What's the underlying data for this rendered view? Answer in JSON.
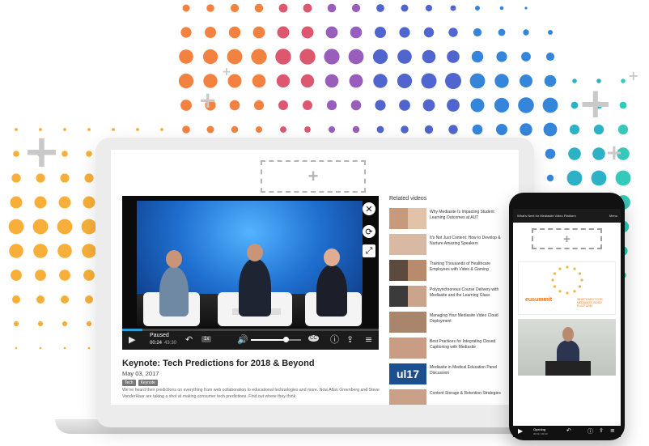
{
  "colors": {
    "accent_blue": "#2d9cdb",
    "player_bg": "#0b0b0b",
    "brand_orange": "#e8761c"
  },
  "laptop": {
    "ad_slot_icon": "+",
    "player": {
      "status_label": "Paused",
      "time_current": "00:24",
      "time_total": "43:30",
      "progress": 0.08,
      "volume": 0.7,
      "playback_rate_label": "1x",
      "cc_label": "CC",
      "icons": [
        "play-icon",
        "rewind-icon",
        "volume-icon",
        "closed-captions-icon",
        "info-icon",
        "share-icon",
        "menu-icon",
        "close-icon",
        "refresh-icon",
        "expand-icon"
      ]
    },
    "video": {
      "title": "Keynote: Tech Predictions for 2018 & Beyond",
      "date": "May 03, 2017",
      "tags": [
        "Tech",
        "Keynote"
      ],
      "description": "We've heard their predictions on everything from web collaboration to educational technologies and more. Now Allan Greenberg and Steve VonderHaar are taking a shot at making consumer tech predictions. Find out where they think"
    },
    "related": {
      "heading": "Related videos",
      "items": [
        {
          "title": "Why Mediasite Is Impacting Student Learning Outcomes at AUT"
        },
        {
          "title": "It's Not Just Content: How to Develop & Nurture Amazing Speakers"
        },
        {
          "title": "Training Thousands of Healthcare Employees with Video & Gaming"
        },
        {
          "title": "Polysynchronous Course Delivery with Mediasite and the Learning Glass"
        },
        {
          "title": "Managing Your Mediasite Video Cloud Deployment"
        },
        {
          "title": "Best Practices for Integrating Closed Captioning with Mediasite"
        },
        {
          "title": "Mediasite in Medical Education Panel Discussion"
        },
        {
          "title": "Content Storage & Retention Strategies"
        }
      ]
    }
  },
  "phone": {
    "header_title": "What's Next for Mediasite Video Platform",
    "menu_label": "Menu",
    "ad_slot_icon": "+",
    "event_logo": "eusummit",
    "event_tagline": "WHAT'S NEXT FOR MEDIASITE VIDEO PLATFORM",
    "status_label": "Opening",
    "time_label": "00:00 / 00:00"
  }
}
